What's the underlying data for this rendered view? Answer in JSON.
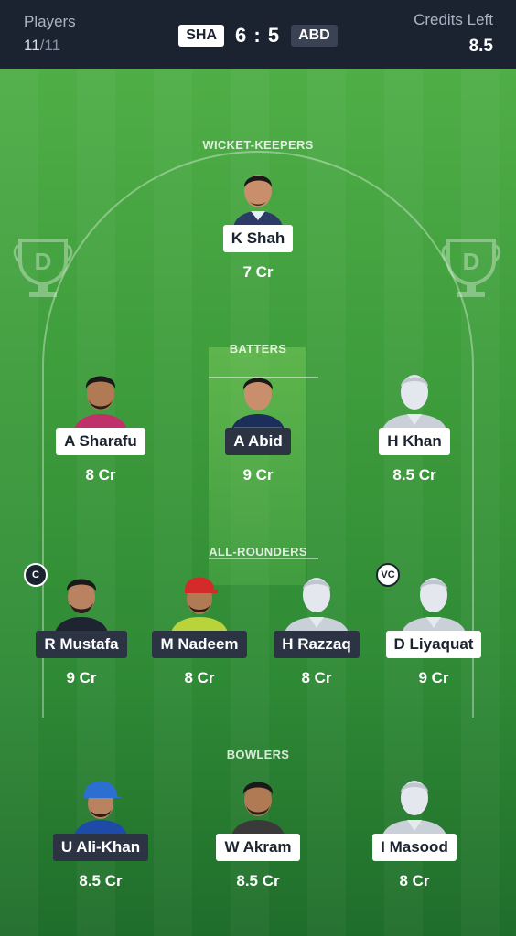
{
  "header": {
    "players_label": "Players",
    "players_count": "11",
    "players_total": "/11",
    "home_team": "SHA",
    "score": "6 : 5",
    "away_team": "ABD",
    "credits_label": "Credits Left",
    "credits_value": "8.5"
  },
  "sections": {
    "wicket_keepers": "WICKET-KEEPERS",
    "batters": "BATTERS",
    "all_rounders": "ALL-ROUNDERS",
    "bowlers": "BOWLERS"
  },
  "players": {
    "wk1": {
      "name": "K Shah",
      "credits": "7 Cr",
      "team": "home",
      "avatar": "player-photo"
    },
    "bat1": {
      "name": "A Sharafu",
      "credits": "8 Cr",
      "team": "home",
      "avatar": "player-photo"
    },
    "bat2": {
      "name": "A Abid",
      "credits": "9 Cr",
      "team": "away",
      "avatar": "player-photo"
    },
    "bat3": {
      "name": "H Khan",
      "credits": "8.5 Cr",
      "team": "home",
      "avatar": "silhouette"
    },
    "ar1": {
      "name": "R Mustafa",
      "credits": "9 Cr",
      "team": "away",
      "avatar": "player-photo",
      "role": "C"
    },
    "ar2": {
      "name": "M Nadeem",
      "credits": "8 Cr",
      "team": "away",
      "avatar": "player-photo"
    },
    "ar3": {
      "name": "H Razzaq",
      "credits": "8 Cr",
      "team": "away",
      "avatar": "silhouette"
    },
    "ar4": {
      "name": "D Liyaquat",
      "credits": "9 Cr",
      "team": "home",
      "avatar": "silhouette",
      "role": "VC"
    },
    "bowl1": {
      "name": "U Ali-Khan",
      "credits": "8.5 Cr",
      "team": "away",
      "avatar": "player-photo"
    },
    "bowl2": {
      "name": "W Akram",
      "credits": "8.5 Cr",
      "team": "home",
      "avatar": "player-photo"
    },
    "bowl3": {
      "name": "I Masood",
      "credits": "8 Cr",
      "team": "home",
      "avatar": "silhouette"
    }
  },
  "colors": {
    "topbar": "#1c2330",
    "field_top": "#4fae46",
    "field_bottom": "#1f6d2b",
    "chip_light": "#ffffff",
    "chip_dark": "#2c3444"
  }
}
